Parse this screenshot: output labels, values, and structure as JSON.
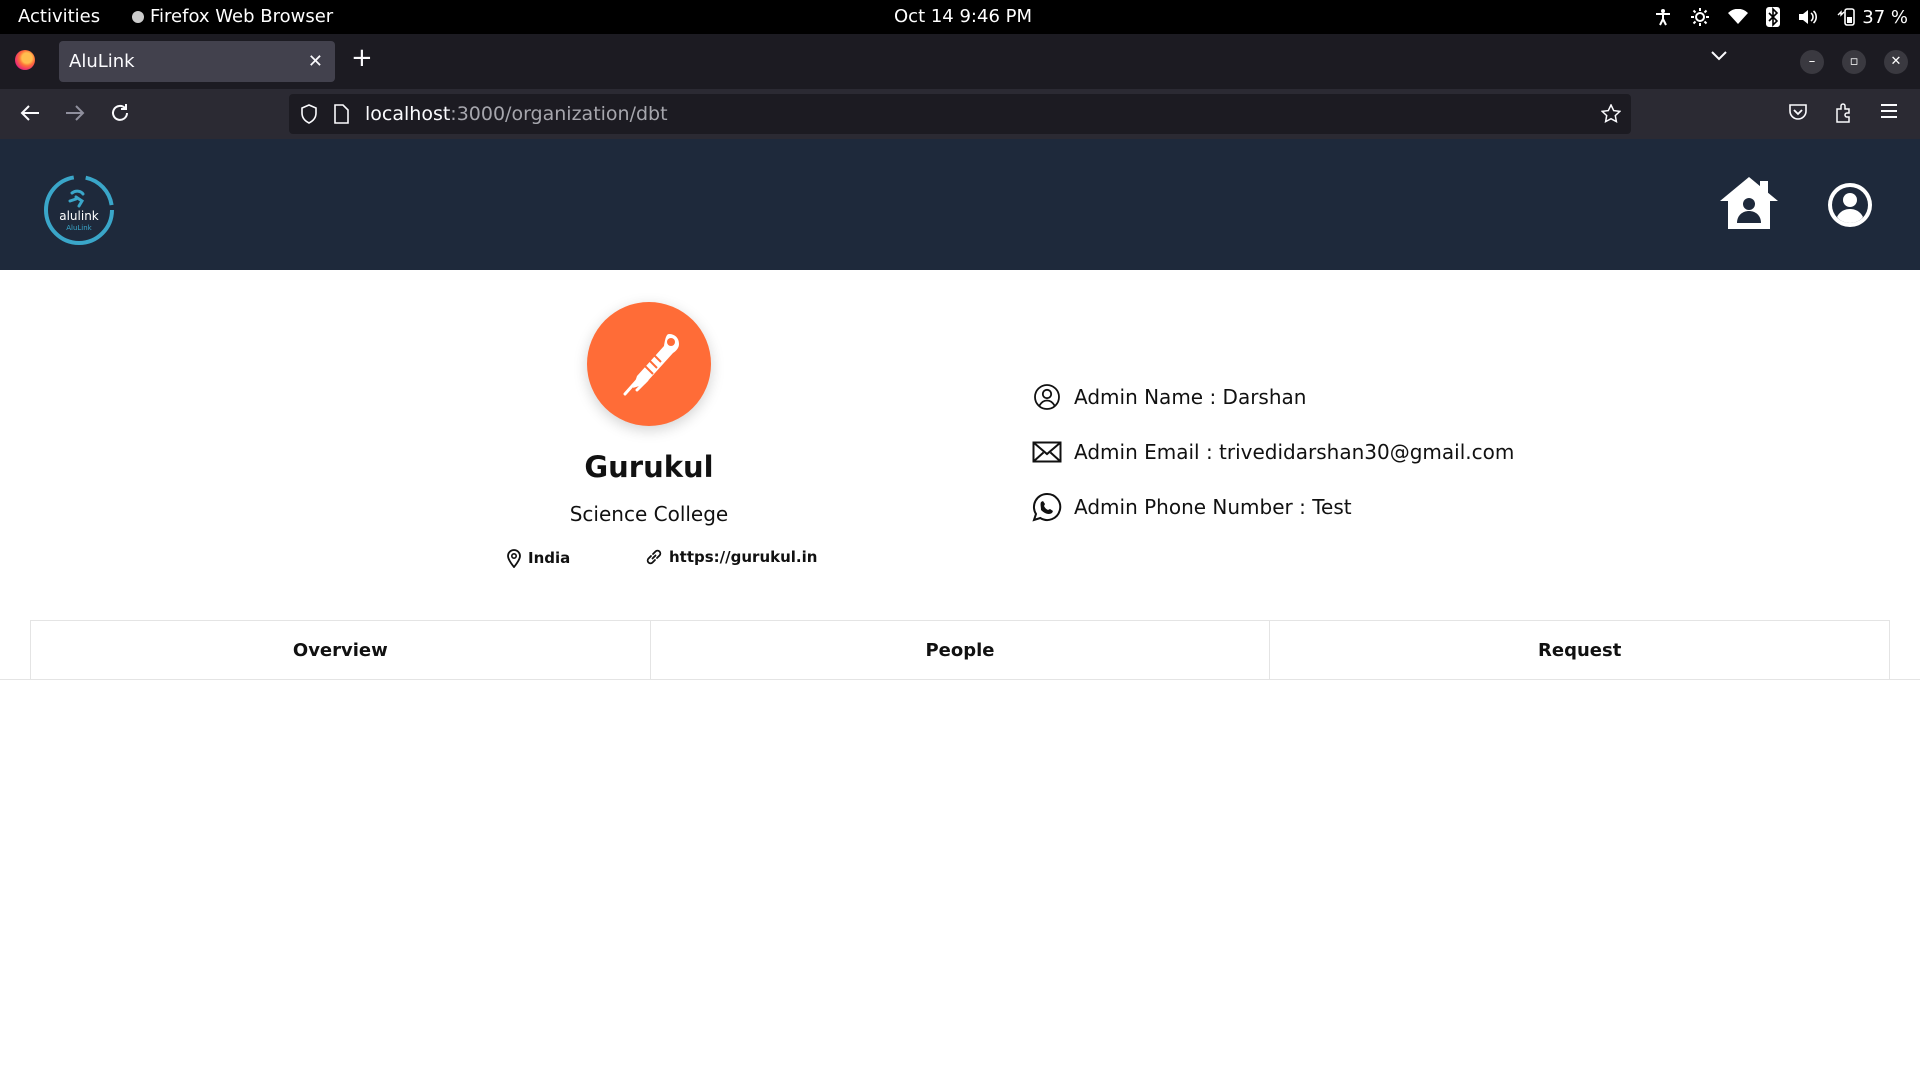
{
  "system": {
    "activities": "Activities",
    "app_name": "Firefox Web Browser",
    "clock": "Oct 14  9:46 PM",
    "battery": "37 %"
  },
  "browser": {
    "tab_title": "AluLink",
    "url_host": "localhost",
    "url_path": ":3000/organization/dbt"
  },
  "app": {
    "logo_text_1": "alulink",
    "logo_text_2": "AluLink",
    "accent_color": "#ff6c37",
    "header_color": "#1e293b"
  },
  "organization": {
    "name": "Gurukul",
    "type": "Science College",
    "location": "India",
    "website": "https://gurukul.in"
  },
  "admin": {
    "name_label": "Admin Name : Darshan",
    "email_label": "Admin Email : trivedidarshan30@gmail.com",
    "phone_label": "Admin Phone Number : Test"
  },
  "tabs": [
    {
      "label": "Overview"
    },
    {
      "label": "People"
    },
    {
      "label": "Request"
    }
  ],
  "icons": {
    "accessibility": "accessibility-icon",
    "brightness": "brightness-icon",
    "wifi": "wifi-icon",
    "bluetooth": "bluetooth-icon",
    "volume": "volume-icon",
    "battery": "battery-icon",
    "home": "house-user-icon",
    "profile": "user-circle-icon",
    "location": "map-pin-icon",
    "link": "link-icon",
    "admin_name": "user-circle-outline-icon",
    "admin_email": "envelope-icon",
    "admin_phone": "whatsapp-icon"
  }
}
